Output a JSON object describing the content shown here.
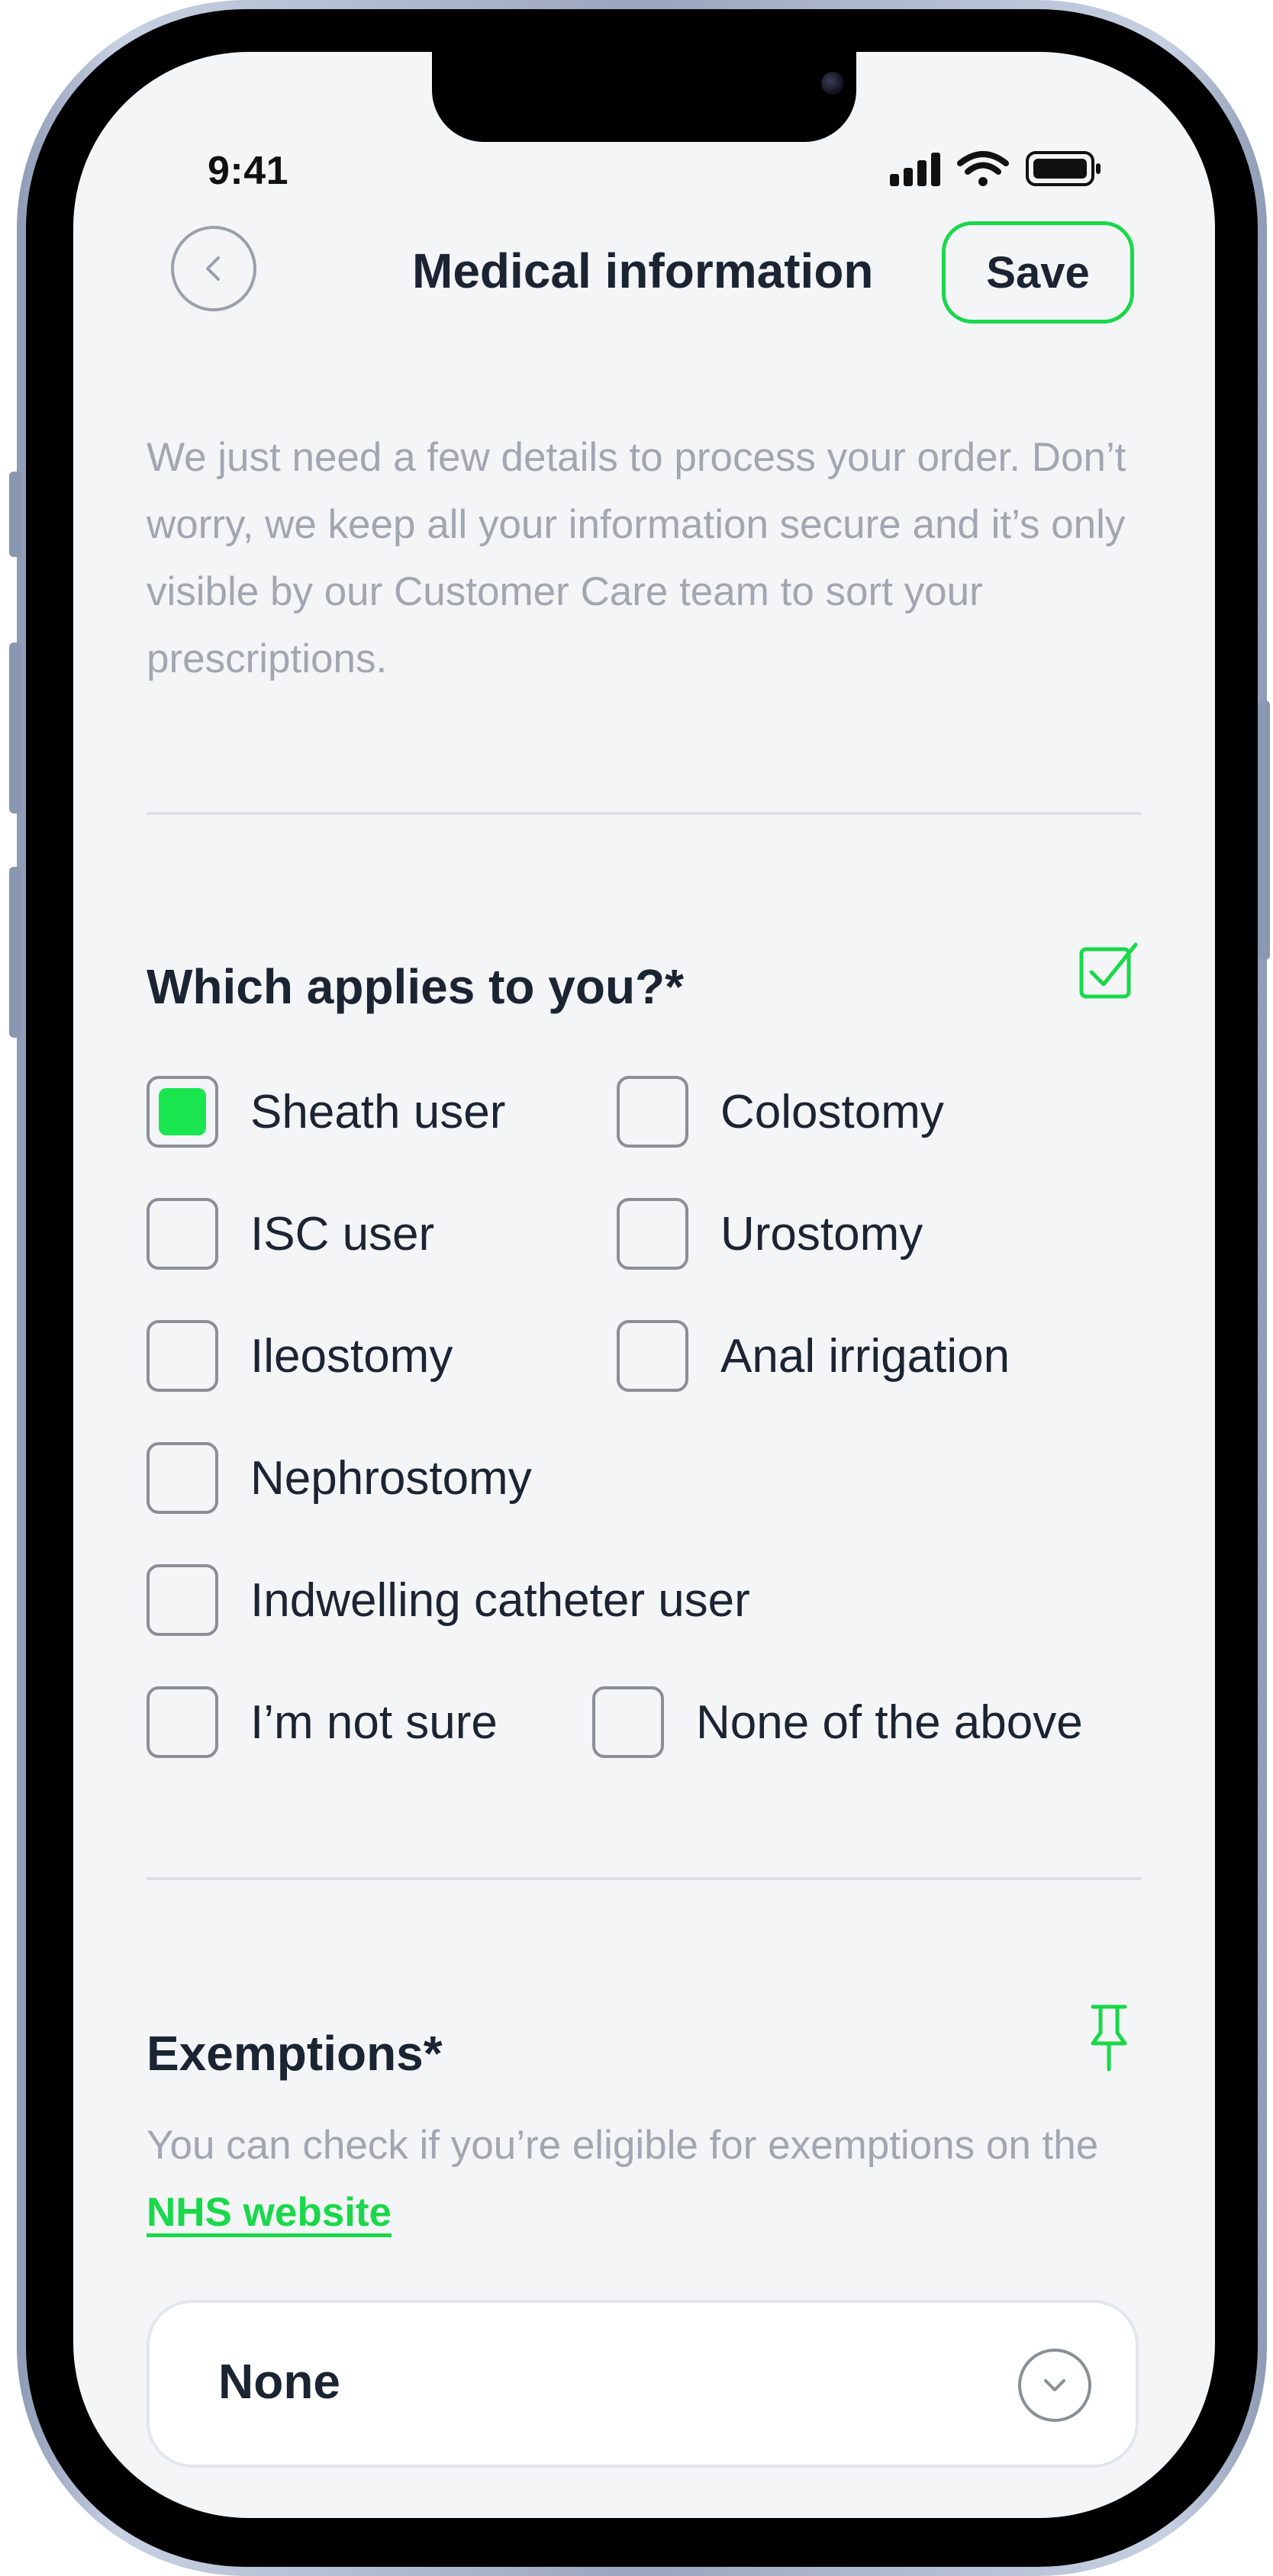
{
  "status_bar": {
    "time": "9:41"
  },
  "header": {
    "title": "Medical information",
    "save_label": "Save"
  },
  "intro_text": "We just need a few details to process your order. Don’t worry, we keep all your information secure and it’s only visible by our Customer Care team to sort your prescriptions.",
  "applies": {
    "title": "Which applies to you?*",
    "options": [
      {
        "label": "Sheath user",
        "checked": true
      },
      {
        "label": "Colostomy",
        "checked": false
      },
      {
        "label": "ISC user",
        "checked": false
      },
      {
        "label": "Urostomy",
        "checked": false
      },
      {
        "label": "Ileostomy",
        "checked": false
      },
      {
        "label": "Anal irrigation",
        "checked": false
      },
      {
        "label": "Nephrostomy",
        "checked": false
      },
      {
        "label": "Indwelling catheter user",
        "checked": false
      },
      {
        "label": "I’m not sure",
        "checked": false
      },
      {
        "label": "None of the above",
        "checked": false
      }
    ]
  },
  "exemptions": {
    "title": "Exemptions*",
    "text_before": "You can check if you’re eligible for exemptions on the ",
    "link_label": "NHS website",
    "selected_value": "None"
  },
  "colors": {
    "accent": "#19d84a",
    "checkbox_fill": "#19e64f",
    "text": "#1b2432",
    "muted": "#a1a7b0"
  }
}
